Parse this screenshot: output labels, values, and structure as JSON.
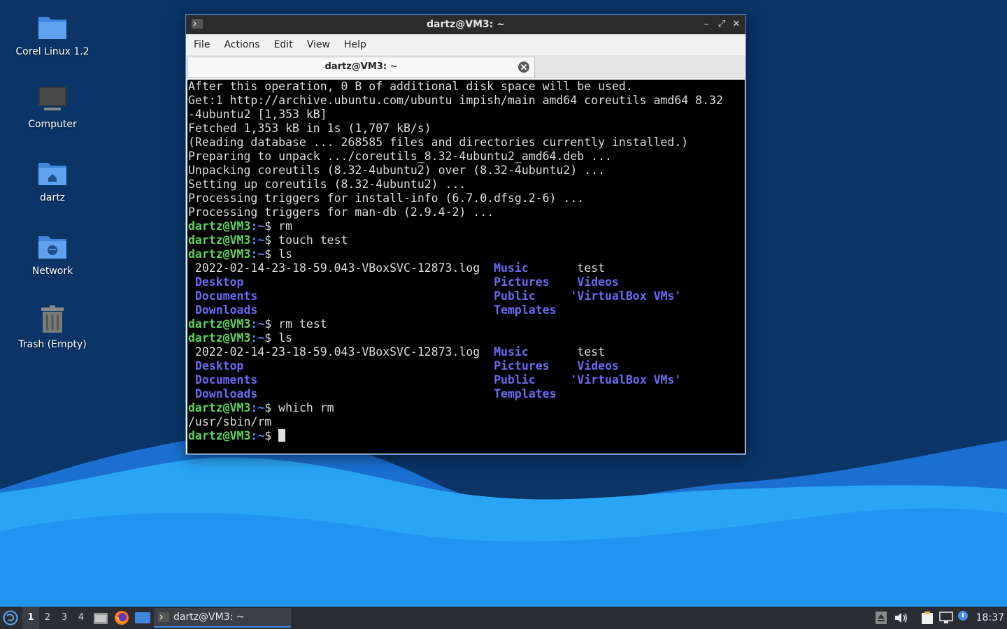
{
  "desktop": {
    "icons": [
      {
        "label": "Corel Linux 1.2",
        "icon": "folder-icon"
      },
      {
        "label": "Computer",
        "icon": "computer-icon"
      },
      {
        "label": "dartz",
        "icon": "home-folder-icon"
      },
      {
        "label": "Network",
        "icon": "network-folder-icon"
      },
      {
        "label": "Trash (Empty)",
        "icon": "trash-icon"
      }
    ],
    "colors": {
      "bg_dark": "#0a3566",
      "wave_light": "#2aa4f4",
      "wave_mid": "#1a7de0"
    }
  },
  "window": {
    "title": "dartz@VM3: ~",
    "controls": {
      "minimize": "–",
      "maximize": "⤢",
      "close": "✕"
    },
    "menu": [
      "File",
      "Actions",
      "Edit",
      "View",
      "Help"
    ],
    "tab_title": "dartz@VM3: ~"
  },
  "terminal": {
    "lines": [
      [
        {
          "t": "After this operation, 0 B of additional disk space will be used.",
          "c": ""
        }
      ],
      [
        {
          "t": "Get:1 http://archive.ubuntu.com/ubuntu impish/main amd64 coreutils amd64 8.32",
          "c": ""
        }
      ],
      [
        {
          "t": "-4ubuntu2 [1,353 kB]",
          "c": ""
        }
      ],
      [
        {
          "t": "Fetched 1,353 kB in 1s (1,707 kB/s)",
          "c": ""
        }
      ],
      [
        {
          "t": "(Reading database ... 268585 files and directories currently installed.)",
          "c": ""
        }
      ],
      [
        {
          "t": "Preparing to unpack .../coreutils_8.32-4ubuntu2_amd64.deb ...",
          "c": ""
        }
      ],
      [
        {
          "t": "Unpacking coreutils (8.32-4ubuntu2) over (8.32-4ubuntu2) ...",
          "c": ""
        }
      ],
      [
        {
          "t": "Setting up coreutils (8.32-4ubuntu2) ...",
          "c": ""
        }
      ],
      [
        {
          "t": "Processing triggers for install-info (6.7.0.dfsg.2-6) ...",
          "c": ""
        }
      ],
      [
        {
          "t": "Processing triggers for man-db (2.9.4-2) ...",
          "c": ""
        }
      ],
      [
        {
          "t": "dartz@VM3",
          "c": "pu"
        },
        {
          "t": ":~",
          "c": "pp"
        },
        {
          "t": "$ rm",
          "c": ""
        }
      ],
      [
        {
          "t": "dartz@VM3",
          "c": "pu"
        },
        {
          "t": ":~",
          "c": "pp"
        },
        {
          "t": "$ touch test",
          "c": ""
        }
      ],
      [
        {
          "t": "dartz@VM3",
          "c": "pu"
        },
        {
          "t": ":~",
          "c": "pp"
        },
        {
          "t": "$ ls",
          "c": ""
        }
      ],
      [
        {
          "t": " 2022-02-14-23-18-59.043-VBoxSVC-12873.log  ",
          "c": ""
        },
        {
          "t": "Music",
          "c": "dir"
        },
        {
          "t": "       test",
          "c": ""
        }
      ],
      [
        {
          "t": " ",
          "c": ""
        },
        {
          "t": "Desktop",
          "c": "dir"
        },
        {
          "t": "                                    ",
          "c": ""
        },
        {
          "t": "Pictures",
          "c": "dir"
        },
        {
          "t": "    ",
          "c": ""
        },
        {
          "t": "Videos",
          "c": "dir"
        }
      ],
      [
        {
          "t": " ",
          "c": ""
        },
        {
          "t": "Documents",
          "c": "dir"
        },
        {
          "t": "                                  ",
          "c": ""
        },
        {
          "t": "Public",
          "c": "dir"
        },
        {
          "t": "     ",
          "c": ""
        },
        {
          "t": "'VirtualBox VMs'",
          "c": "dir"
        }
      ],
      [
        {
          "t": " ",
          "c": ""
        },
        {
          "t": "Downloads",
          "c": "dir"
        },
        {
          "t": "                                  ",
          "c": ""
        },
        {
          "t": "Templates",
          "c": "dir"
        }
      ],
      [
        {
          "t": "dartz@VM3",
          "c": "pu"
        },
        {
          "t": ":~",
          "c": "pp"
        },
        {
          "t": "$ rm test",
          "c": ""
        }
      ],
      [
        {
          "t": "dartz@VM3",
          "c": "pu"
        },
        {
          "t": ":~",
          "c": "pp"
        },
        {
          "t": "$ ls",
          "c": ""
        }
      ],
      [
        {
          "t": " 2022-02-14-23-18-59.043-VBoxSVC-12873.log  ",
          "c": ""
        },
        {
          "t": "Music",
          "c": "dir"
        },
        {
          "t": "       test",
          "c": ""
        }
      ],
      [
        {
          "t": " ",
          "c": ""
        },
        {
          "t": "Desktop",
          "c": "dir"
        },
        {
          "t": "                                    ",
          "c": ""
        },
        {
          "t": "Pictures",
          "c": "dir"
        },
        {
          "t": "    ",
          "c": ""
        },
        {
          "t": "Videos",
          "c": "dir"
        }
      ],
      [
        {
          "t": " ",
          "c": ""
        },
        {
          "t": "Documents",
          "c": "dir"
        },
        {
          "t": "                                  ",
          "c": ""
        },
        {
          "t": "Public",
          "c": "dir"
        },
        {
          "t": "     ",
          "c": ""
        },
        {
          "t": "'VirtualBox VMs'",
          "c": "dir"
        }
      ],
      [
        {
          "t": " ",
          "c": ""
        },
        {
          "t": "Downloads",
          "c": "dir"
        },
        {
          "t": "                                  ",
          "c": ""
        },
        {
          "t": "Templates",
          "c": "dir"
        }
      ],
      [
        {
          "t": "dartz@VM3",
          "c": "pu"
        },
        {
          "t": ":~",
          "c": "pp"
        },
        {
          "t": "$ which rm",
          "c": ""
        }
      ],
      [
        {
          "t": "/usr/sbin/rm",
          "c": ""
        }
      ],
      [
        {
          "t": "dartz@VM3",
          "c": "pu"
        },
        {
          "t": ":~",
          "c": "pp"
        },
        {
          "t": "$ ",
          "c": ""
        }
      ]
    ],
    "colors": {
      "prompt_user": "#5fd35f",
      "prompt_path": "#4d8cf2",
      "directory": "#6a6af2",
      "text": "#dcdcdc",
      "bg": "#000000"
    }
  },
  "taskbar": {
    "start_icon": "start-menu-icon",
    "workspaces": [
      "1",
      "2",
      "3",
      "4"
    ],
    "active_workspace": "1",
    "launchers": [
      "file-manager-icon",
      "firefox-icon",
      "show-desktop-icon"
    ],
    "task": {
      "label": "dartz@VM3: ~",
      "icon": "terminal-icon"
    },
    "tray": [
      "eject-icon",
      "volume-icon",
      "clipboard-icon",
      "network-status-icon",
      "notification-icon"
    ],
    "clock": "18:37"
  }
}
